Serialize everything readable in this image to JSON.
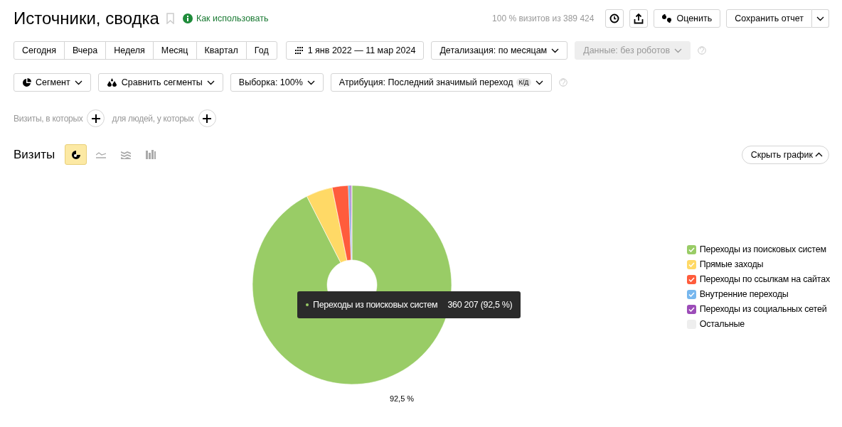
{
  "header": {
    "title": "Источники, сводка",
    "help_link": "Как использовать",
    "visits_share": "100 % визитов из 389 424",
    "rate_button": "Оценить",
    "save_button": "Сохранить отчет"
  },
  "periods": [
    {
      "label": "Сегодня",
      "selected": false
    },
    {
      "label": "Вчера",
      "selected": false
    },
    {
      "label": "Неделя",
      "selected": false
    },
    {
      "label": "Месяц",
      "selected": false
    },
    {
      "label": "Квартал",
      "selected": false
    },
    {
      "label": "Год",
      "selected": false
    }
  ],
  "date_range": "1 янв 2022 — 11 мар 2024",
  "detail_dropdown": "Детализация: по месяцам",
  "data_dropdown": {
    "label": "Данные: без роботов",
    "disabled": true
  },
  "segment_dropdown": "Сегмент",
  "compare_dropdown": "Сравнить сегменты",
  "sample_dropdown": "Выборка: 100%",
  "attribution_dropdown": {
    "label": "Атрибуция: Последний значимый переход",
    "badge": "К/Д"
  },
  "filters": [
    "Визиты, в которых",
    "для людей, у которых"
  ],
  "chart_section": {
    "chart_types": [
      {
        "kind": "pie",
        "selected": true
      },
      {
        "kind": "line",
        "selected": false
      },
      {
        "kind": "area",
        "selected": false
      },
      {
        "kind": "bars",
        "selected": false
      }
    ],
    "hide_button": "Скрыть график",
    "chart_data": {
      "type": "donut",
      "categories": [
        "Переходы из поисковых систем",
        "Прямые заходы",
        "Переходы по ссылкам на сайтах",
        "Внутренние переходы",
        "Переходы из социальных сетей",
        "Остальные"
      ],
      "series": [
        {
          "name": "Визиты",
          "values": [
            92.5,
            4.3,
            2.6,
            0.3,
            0.2,
            0.1
          ]
        }
      ],
      "value_labels": [
        "92,5 %",
        null,
        null,
        null,
        null,
        null
      ]
    },
    "tooltip": {
      "label": "Переходы из поисковых систем",
      "value": "360 207 (92,5 %)"
    },
    "legend": [
      {
        "color": "#99cc66",
        "checked": true
      },
      {
        "color": "#ffd966",
        "checked": true
      },
      {
        "color": "#ff5c3c",
        "checked": true
      },
      {
        "color": "#77b7ee",
        "checked": true
      },
      {
        "color": "#9c4cb8",
        "checked": true
      },
      {
        "color": "#eeeeee",
        "checked": false
      }
    ]
  }
}
